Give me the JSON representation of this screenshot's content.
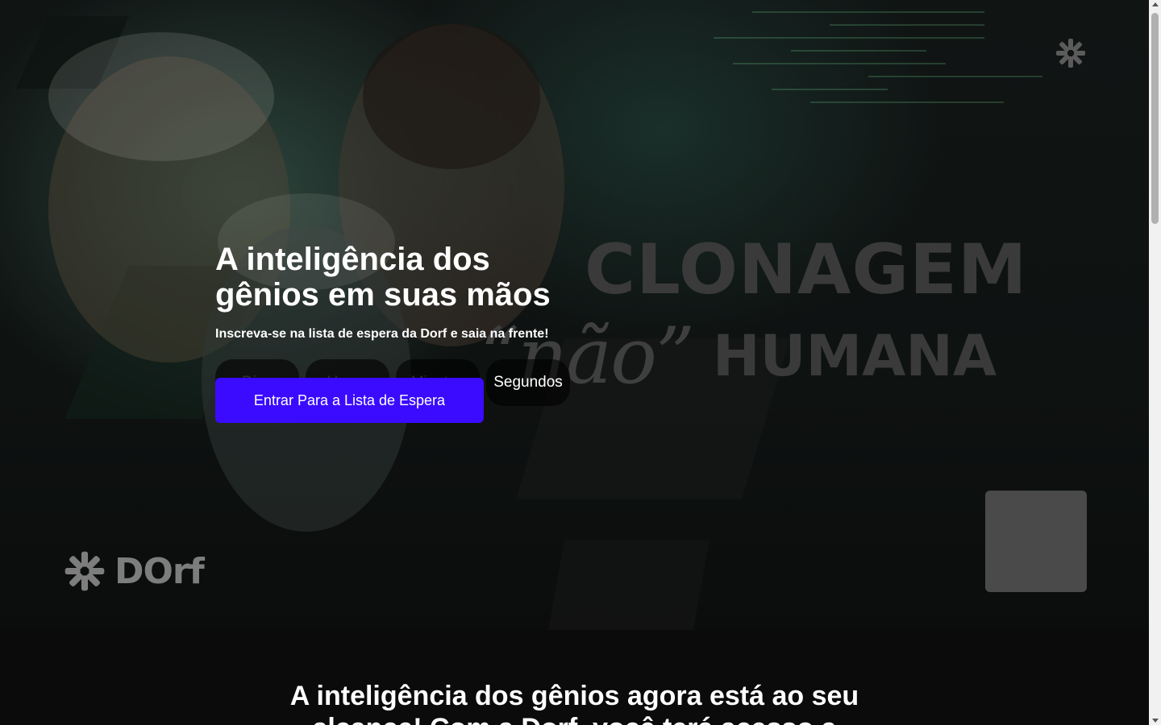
{
  "hero": {
    "headline": "A inteligência dos gênios em suas mãos",
    "subheadline": "Inscreva-se na lista de espera da Dorf e saia na frente!",
    "watermark": {
      "line1": "CLONAGEM",
      "nao": "“não”",
      "humana": "HUMANA"
    },
    "countdown": {
      "days_label": "Dias",
      "hours_label": "Horas",
      "minutes_label": "Minutos",
      "seconds_label": "Segundos"
    },
    "cta_label": "Entrar Para a Lista de Espera",
    "brand_name": "Dorf",
    "brand_logo_text": "DOrf"
  },
  "section2": {
    "title": "A inteligência dos gênios agora está ao seu alcance! Com a Dorf, você terá acesso a"
  },
  "colors": {
    "cta": "#3a0bff",
    "background": "#0b0d0c",
    "watermark": "#3a3a3a"
  },
  "icons": {
    "top_logo": "dorf-snowflake-icon",
    "bottom_logo": "dorf-snowflake-icon"
  }
}
